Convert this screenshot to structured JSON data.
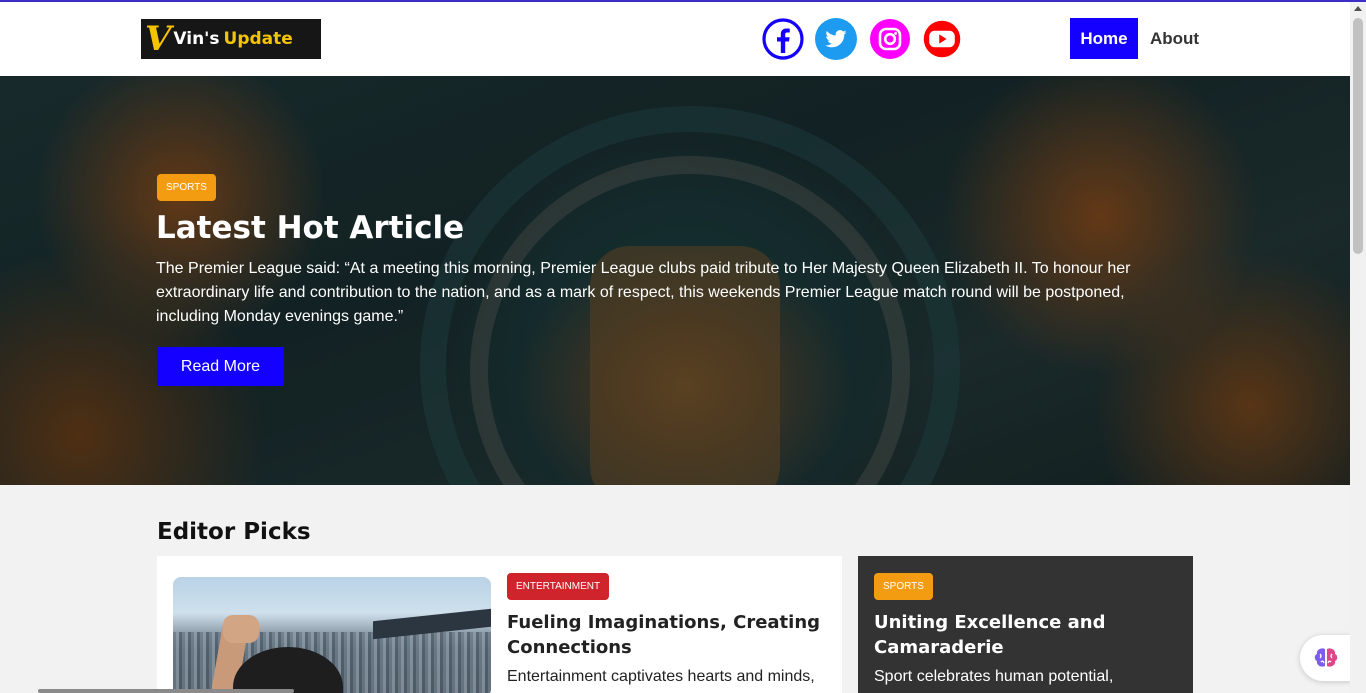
{
  "brand": {
    "logo_letter": "V",
    "logo_part1": "Vin's",
    "logo_part2": "Update",
    "accent": "#1400ff",
    "logo_yellow": "#f5c400"
  },
  "header": {
    "social": [
      {
        "icon": "facebook-icon",
        "color": "#1400ff"
      },
      {
        "icon": "twitter-icon",
        "color": "#1d9bf0"
      },
      {
        "icon": "instagram-icon",
        "color": "#ff00ff"
      },
      {
        "icon": "youtube-icon",
        "color": "#ff0000"
      }
    ],
    "nav": {
      "home": "Home",
      "about": "About"
    }
  },
  "hero": {
    "badge": "SPORTS",
    "title": "Latest Hot Article",
    "text": "The Premier League said: “At a meeting this morning, Premier League clubs paid tribute to Her Majesty Queen Elizabeth II. To honour her extraordinary life and contribution to the nation, and as a mark of respect, this weekends Premier League match round will be postponed, including Monday evenings game.”",
    "button": "Read More"
  },
  "editor_picks": {
    "title": "Editor Picks",
    "cards": [
      {
        "badge": "ENTERTAINMENT",
        "title": "Fueling Imaginations, Creating Connections",
        "text": "Entertainment captivates hearts and minds,"
      },
      {
        "badge": "SPORTS",
        "title": "Uniting Excellence and Camaraderie",
        "text": "Sport celebrates human potential,"
      }
    ]
  }
}
